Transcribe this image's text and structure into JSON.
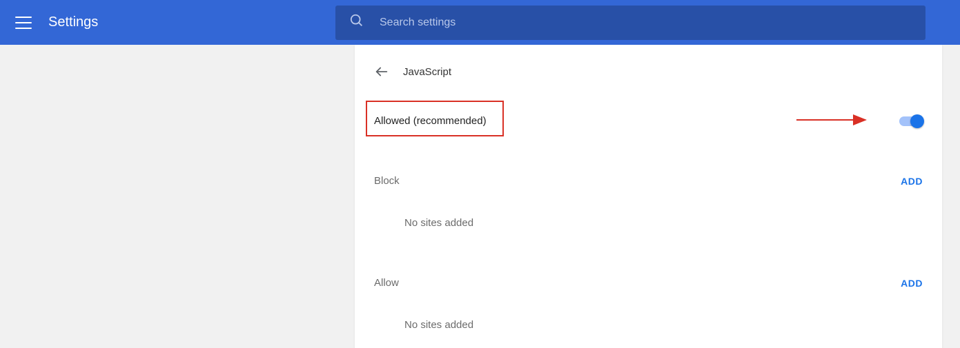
{
  "header": {
    "title": "Settings",
    "search_placeholder": "Search settings"
  },
  "panel": {
    "title": "JavaScript",
    "toggle_label": "Allowed (recommended)",
    "toggle_on": true
  },
  "sections": {
    "block": {
      "title": "Block",
      "add_label": "ADD",
      "empty": "No sites added"
    },
    "allow": {
      "title": "Allow",
      "add_label": "ADD",
      "empty": "No sites added"
    }
  }
}
